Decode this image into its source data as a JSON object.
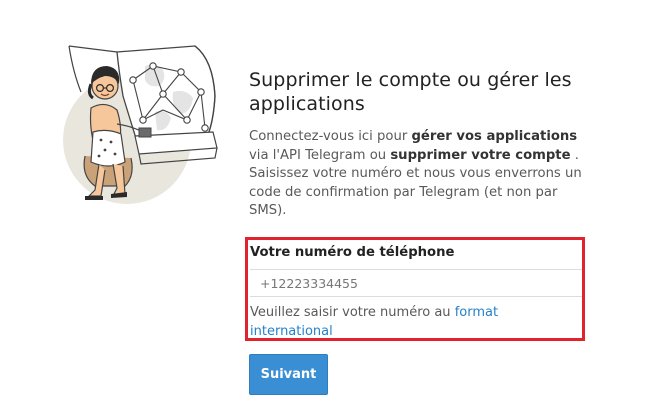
{
  "header": {
    "title": "Supprimer le compte ou gérer les applications"
  },
  "description": {
    "part1": "Connectez-vous ici pour ",
    "bold1": "gérer vos applications",
    "part2": " via l'API Telegram ou ",
    "bold2": "supprimer votre compte",
    "part3": " . Saisissez votre numéro et nous vous enverrons un code de confirmation par Telegram (et non par SMS)."
  },
  "phone_form": {
    "label": "Votre numéro de téléphone",
    "placeholder": "+12223334455",
    "value": "",
    "hint_text": "Veuillez saisir votre numéro au ",
    "hint_link": "format international"
  },
  "next_button": {
    "label": "Suivant"
  },
  "colors": {
    "highlight_border": "#e0232c",
    "button_bg": "#3a8fd4",
    "link": "#2481cc"
  },
  "icons": {
    "illustration": "telegram-user-with-network-map-illustration"
  }
}
